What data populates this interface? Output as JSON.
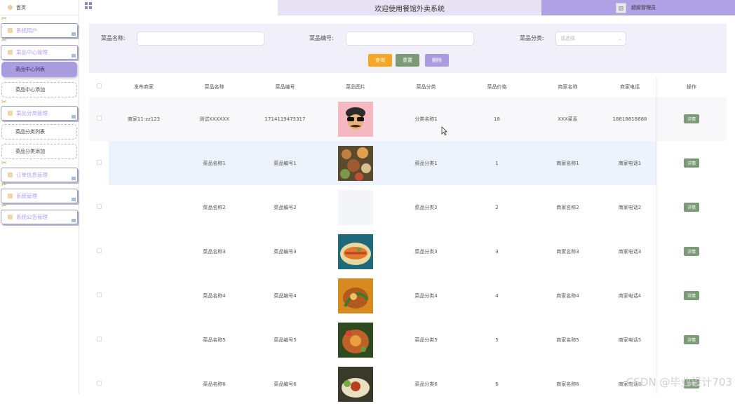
{
  "sidebar": {
    "home": "首页",
    "items": [
      {
        "label": "系统用户",
        "type": "group"
      },
      {
        "label": "菜品中心管理",
        "type": "group"
      },
      {
        "label": "菜品中心列表",
        "type": "sub",
        "active": true
      },
      {
        "label": "菜品中心添加",
        "type": "sub"
      },
      {
        "label": "菜品分类管理",
        "type": "group"
      },
      {
        "label": "菜品分类列表",
        "type": "sub"
      },
      {
        "label": "菜品分类添加",
        "type": "sub"
      },
      {
        "label": "订单信息管理",
        "type": "group"
      },
      {
        "label": "系统管理",
        "type": "group"
      },
      {
        "label": "系统公告管理",
        "type": "group"
      }
    ]
  },
  "header": {
    "title": "欢迎使用餐馆外卖系统",
    "user": "超级管理员"
  },
  "search": {
    "name_label": "菜品名称:",
    "code_label": "菜品编号:",
    "category_label": "菜品分类:",
    "category_placeholder": "请选择",
    "query_button": "查询",
    "reset_button": "重置",
    "delete_button": "删除"
  },
  "table": {
    "headers": [
      "发布商家",
      "菜品名称",
      "菜品编号",
      "菜品图片",
      "菜品分类",
      "菜品价格",
      "商家名称",
      "商家电话",
      "操作"
    ],
    "detail_label": "详情",
    "rows": [
      {
        "merchant": "商家11-zz123",
        "name": "测试XXXXXX",
        "code": "1714119475317",
        "pic": "avatar",
        "category": "分类名称1",
        "price": "18",
        "shop": "XXX菜系",
        "phone": "18818818888"
      },
      {
        "merchant": "",
        "name": "菜品名称1",
        "code": "菜品编号1",
        "pic": "food1",
        "category": "菜品分类1",
        "price": "1",
        "shop": "商家名称1",
        "phone": "商家电话1"
      },
      {
        "merchant": "",
        "name": "菜品名称2",
        "code": "菜品编号2",
        "pic": "blank",
        "category": "菜品分类2",
        "price": "2",
        "shop": "商家名称2",
        "phone": "商家电话2"
      },
      {
        "merchant": "",
        "name": "菜品名称3",
        "code": "菜品编号3",
        "pic": "food3",
        "category": "菜品分类3",
        "price": "3",
        "shop": "商家名称3",
        "phone": "商家电话3"
      },
      {
        "merchant": "",
        "name": "菜品名称4",
        "code": "菜品编号4",
        "pic": "food4",
        "category": "菜品分类4",
        "price": "4",
        "shop": "商家名称4",
        "phone": "商家电话4"
      },
      {
        "merchant": "",
        "name": "菜品名称5",
        "code": "菜品编号5",
        "pic": "food5",
        "category": "菜品分类5",
        "price": "5",
        "shop": "商家名称5",
        "phone": "商家电话5"
      },
      {
        "merchant": "",
        "name": "菜品名称6",
        "code": "菜品编号6",
        "pic": "food6",
        "category": "菜品分类6",
        "price": "6",
        "shop": "商家名称6",
        "phone": "商家电话6"
      }
    ]
  },
  "watermark": "CSDN @毕业设计703",
  "colors": {
    "accent": "#a99de0",
    "query": "#f5a623",
    "reset": "#7c9a78",
    "delete": "#a99de0"
  }
}
